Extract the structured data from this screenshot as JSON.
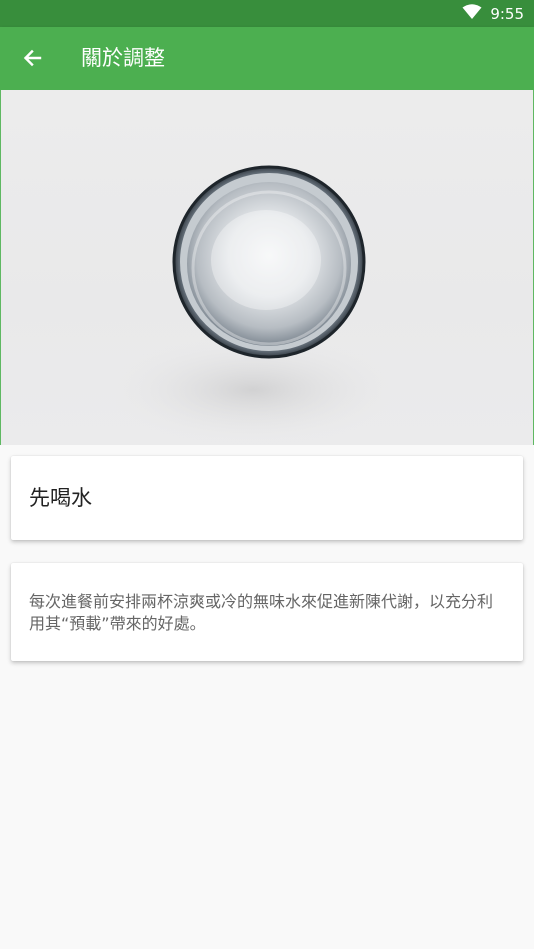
{
  "status_bar": {
    "time": "9:55",
    "wifi_icon": "wifi-icon"
  },
  "app_bar": {
    "back_icon": "arrow-back-icon",
    "title": "關於調整"
  },
  "hero": {
    "image": "glass-of-water-photo"
  },
  "content": {
    "title": "先喝水",
    "description": "每次進餐前安排兩杯涼爽或冷的無味水來促進新陳代謝，以充分利用其“預載”帶來的好處。"
  },
  "colors": {
    "status_bar": "#388e3c",
    "app_bar": "#4caf50",
    "background": "#f9f9f9"
  }
}
